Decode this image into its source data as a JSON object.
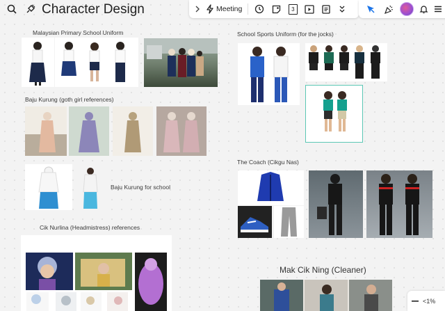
{
  "board": {
    "title": "Character Design"
  },
  "toolbar": {
    "meeting_label": "Meeting",
    "page_number": "3",
    "zoom_level": "<1%",
    "icons": [
      "chevron-right-icon",
      "lightning-icon",
      "timer-icon",
      "sticky-note-icon",
      "page-number-icon",
      "play-icon",
      "notes-icon",
      "chevrons-down-icon",
      "cursor-icon",
      "celebrate-icon",
      "avatar",
      "bell-icon",
      "menu-icon"
    ]
  },
  "sections": {
    "malaysian_uniform": "Malaysian Primary School Uniform",
    "baju_kurung": "Baju Kurung (goth girl references)",
    "baju_kurung_school": "Baju Kurung for school",
    "cik_nurlina": "Cik Nurlina (Headmistress) references",
    "sports_uniform": "School Sports Uniform (for the jocks)",
    "coach": "The Coach (Cikgu Nas)",
    "cleaner": "Mak Cik Ning (Cleaner)"
  },
  "colors": {
    "accent_blue": "#1a73e8",
    "selection_teal": "#5bc7b4",
    "avatar_purple": "#9b4fd1"
  }
}
